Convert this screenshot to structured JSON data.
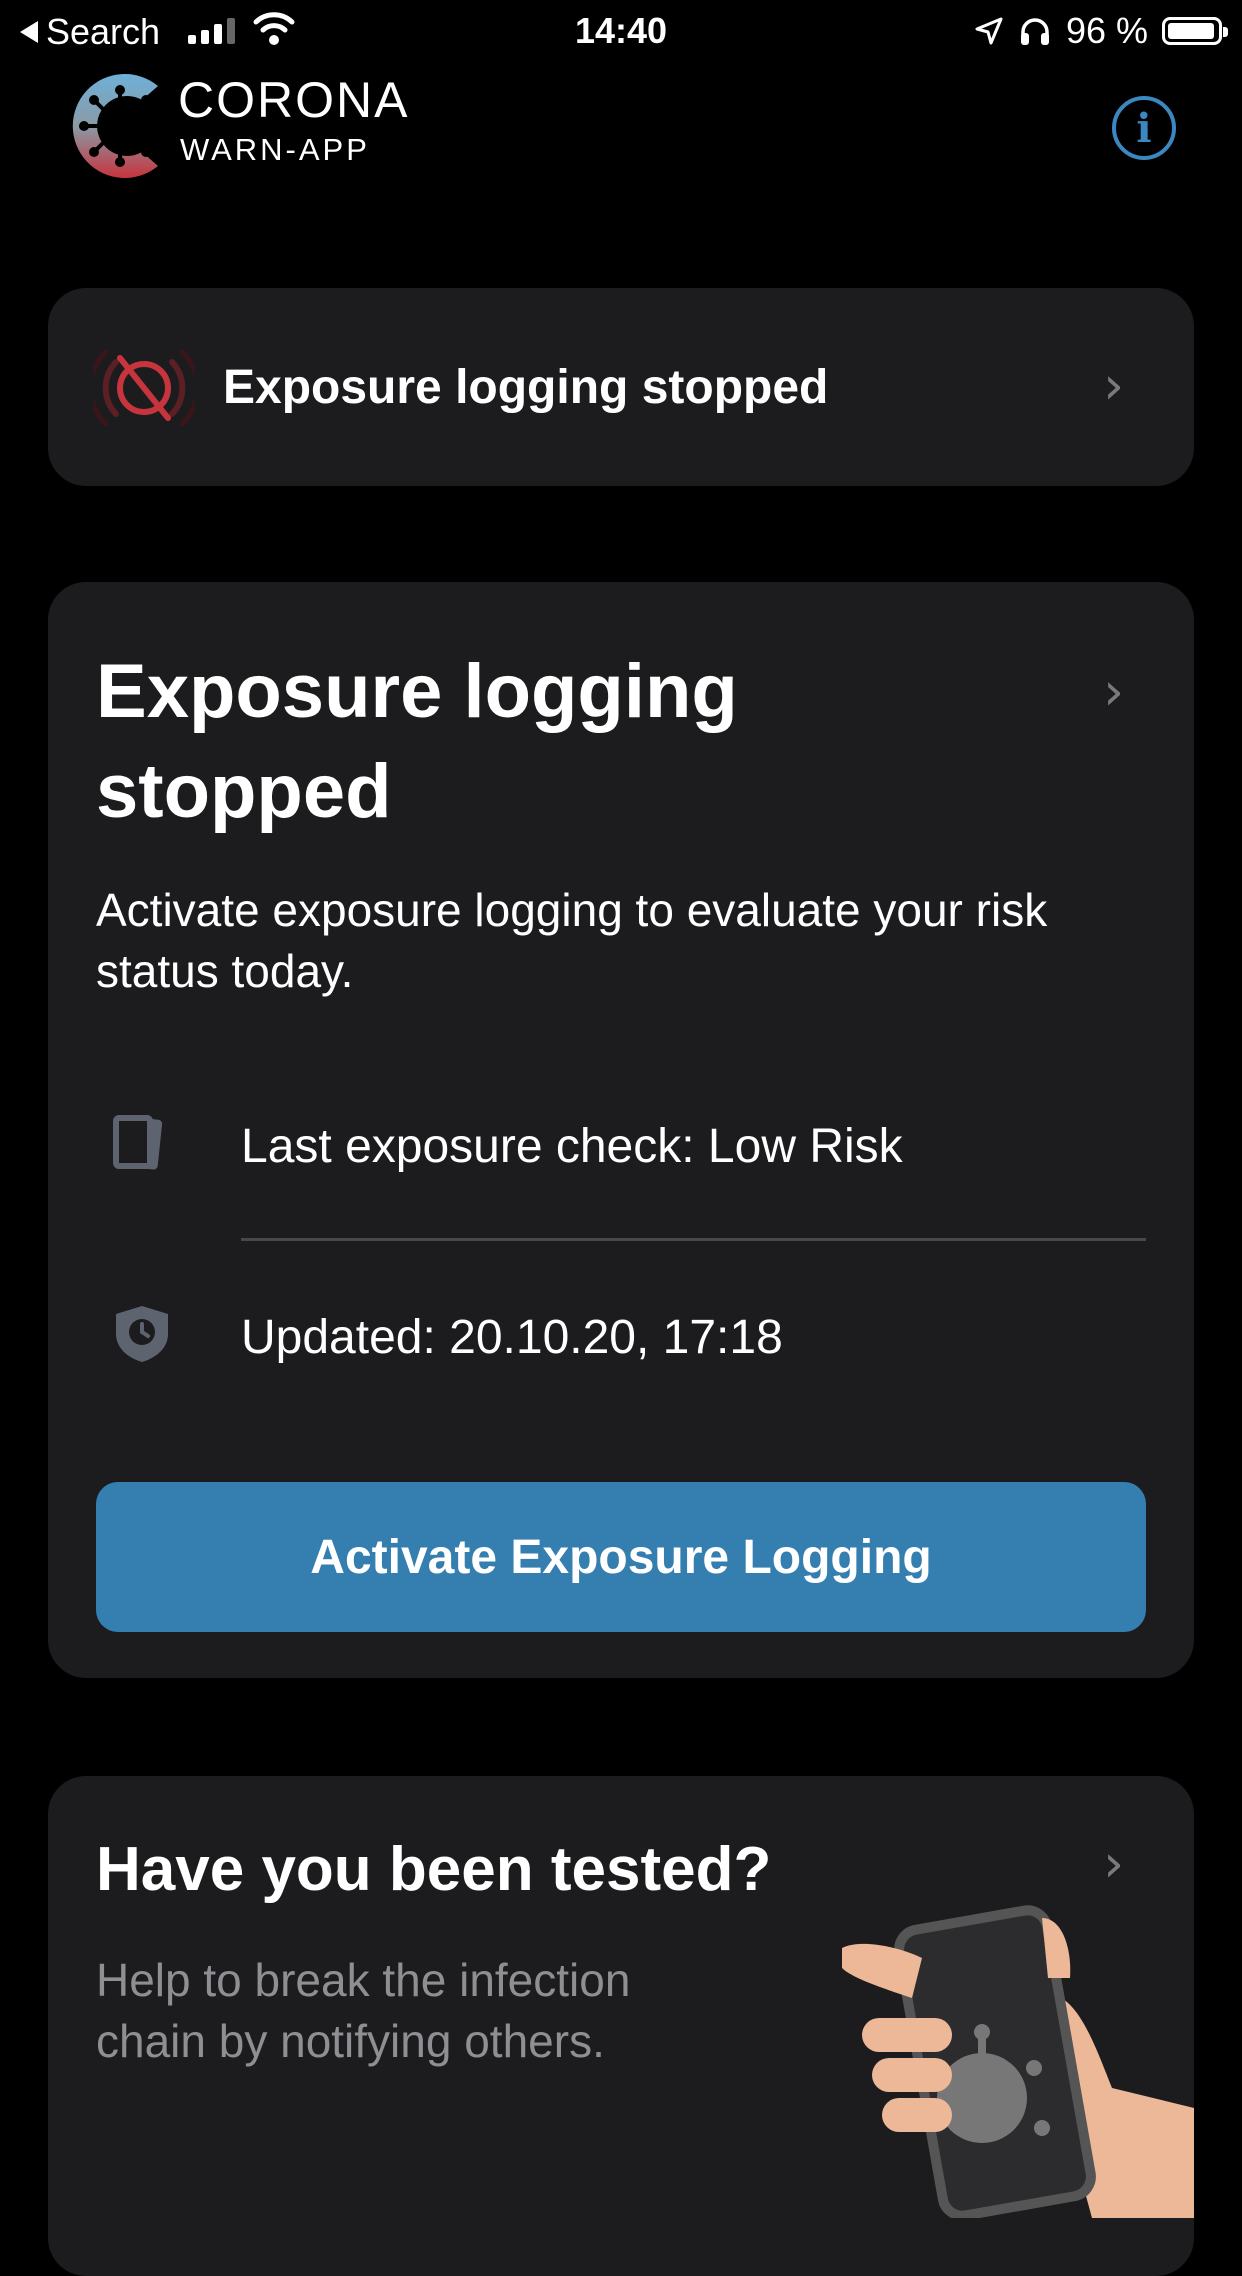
{
  "status_bar": {
    "back_label": "Search",
    "time": "14:40",
    "battery": "96 %"
  },
  "header": {
    "brand_line1": "CORONA",
    "brand_line2": "WARN-APP"
  },
  "exposure_banner": {
    "title": "Exposure logging stopped"
  },
  "risk_card": {
    "title": "Exposure logging stopped",
    "description": "Activate exposure logging to evaluate your risk status today.",
    "last_check": "Last exposure check: Low Risk",
    "updated": "Updated: 20.10.20, 17:18",
    "button_label": "Activate Exposure Logging"
  },
  "test_card": {
    "title": "Have you been tested?",
    "description": "Help to break the infection chain by notifying others."
  },
  "colors": {
    "accent_blue": "#357eb0",
    "info_blue": "#3b87c0",
    "warning_red": "#c6343e",
    "card_bg": "#1c1c1e"
  }
}
